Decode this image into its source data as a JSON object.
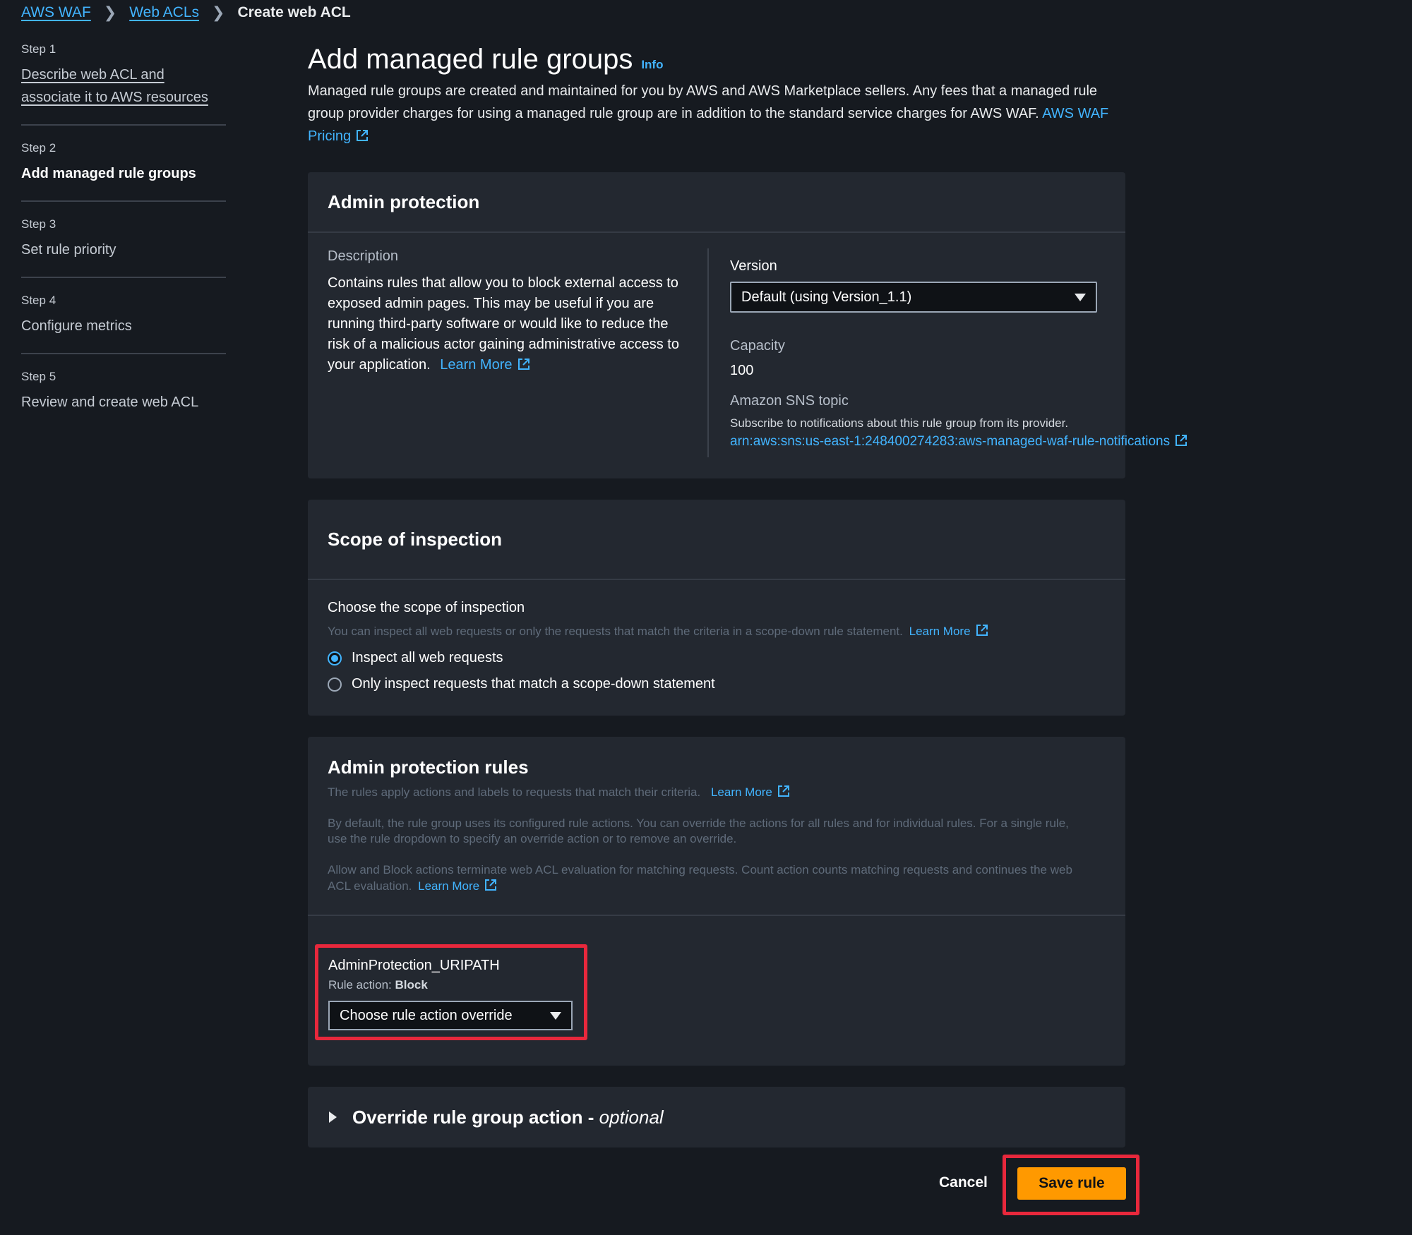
{
  "breadcrumb": {
    "items": [
      "AWS WAF",
      "Web ACLs"
    ],
    "current": "Create web ACL"
  },
  "steps": [
    {
      "label": "Step 1",
      "title": "Describe web ACL and associate it to AWS resources"
    },
    {
      "label": "Step 2",
      "title": "Add managed rule groups"
    },
    {
      "label": "Step 3",
      "title": "Set rule priority"
    },
    {
      "label": "Step 4",
      "title": "Configure metrics"
    },
    {
      "label": "Step 5",
      "title": "Review and create web ACL"
    }
  ],
  "page": {
    "title": "Add managed rule groups",
    "info": "Info",
    "intro": "Managed rule groups are created and maintained for you by AWS and AWS Marketplace sellers. Any fees that a managed rule group provider charges for using a managed rule group are in addition to the standard service charges for AWS WAF.",
    "pricing_link": "AWS WAF Pricing"
  },
  "admin_protection": {
    "title": "Admin protection",
    "description_label": "Description",
    "description": "Contains rules that allow you to block external access to exposed admin pages. This may be useful if you are running third-party software or would like to reduce the risk of a malicious actor gaining administrative access to your application.",
    "learn_more": "Learn More",
    "version_label": "Version",
    "version_value": "Default (using Version_1.1)",
    "capacity_label": "Capacity",
    "capacity_value": "100",
    "sns_label": "Amazon SNS topic",
    "sns_desc": "Subscribe to notifications about this rule group from its provider.",
    "sns_arn": "arn:aws:sns:us-east-1:248400274283:aws-managed-waf-rule-notifications"
  },
  "scope": {
    "title": "Scope of inspection",
    "subtitle": "Choose the scope of inspection",
    "desc": "You can inspect all web requests or only the requests that match the criteria in a scope-down rule statement.",
    "learn_more": "Learn More",
    "options": [
      "Inspect all web requests",
      "Only inspect requests that match a scope-down statement"
    ],
    "selected": 0
  },
  "rules": {
    "title": "Admin protection rules",
    "desc": "The rules apply actions and labels to requests that match their criteria.",
    "learn_more": "Learn More",
    "para1": "By default, the rule group uses its configured rule actions. You can override the actions for all rules and for individual rules. For a single rule, use the rule dropdown to specify an override action or to remove an override.",
    "para2": "Allow and Block actions terminate web ACL evaluation for matching requests. Count action counts matching requests and continues the web ACL evaluation.",
    "learn_more2": "Learn More",
    "rule_name": "AdminProtection_URIPATH",
    "rule_action_label": "Rule action:",
    "rule_action_value": "Block",
    "override_placeholder": "Choose rule action override"
  },
  "override": {
    "title": "Override rule group action - ",
    "optional": "optional"
  },
  "footer": {
    "cancel": "Cancel",
    "save": "Save rule"
  },
  "colors": {
    "accent_link": "#42b4ff",
    "primary_button": "#ff9900",
    "highlight": "#e8283c"
  }
}
